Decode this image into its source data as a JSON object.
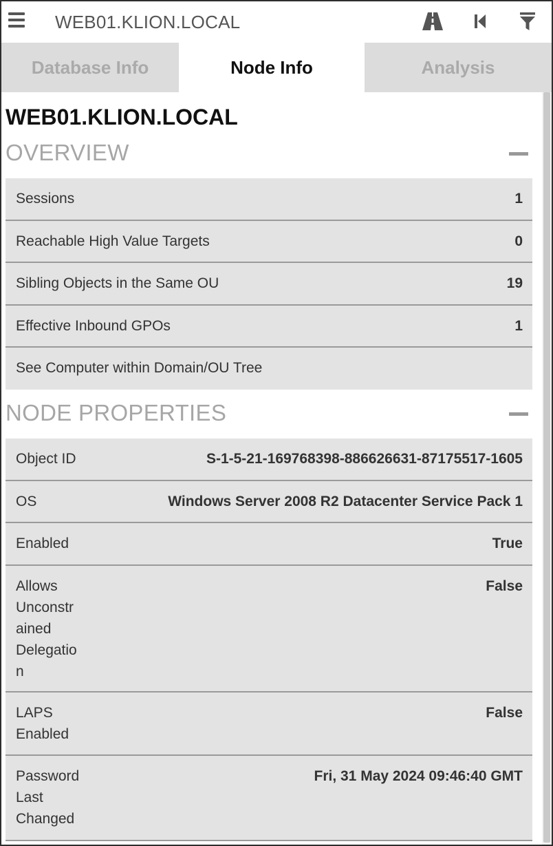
{
  "header": {
    "title": "WEB01.KLION.LOCAL",
    "icons": [
      "menu-icon",
      "road-icon",
      "back-icon",
      "filter-icon"
    ]
  },
  "tabs": [
    {
      "label": "Database Info",
      "active": false
    },
    {
      "label": "Node Info",
      "active": true
    },
    {
      "label": "Analysis",
      "active": false
    }
  ],
  "node": {
    "name": "WEB01.KLION.LOCAL"
  },
  "overview": {
    "title": "OVERVIEW",
    "rows": [
      {
        "label": "Sessions",
        "value": "1"
      },
      {
        "label": "Reachable High Value Targets",
        "value": "0"
      },
      {
        "label": "Sibling Objects in the Same OU",
        "value": "19"
      },
      {
        "label": "Effective Inbound GPOs",
        "value": "1"
      },
      {
        "label": "See Computer within Domain/OU Tree",
        "value": ""
      }
    ]
  },
  "properties": {
    "title": "NODE PROPERTIES",
    "rows": [
      {
        "label": "Object ID",
        "value": "S-1-5-21-169768398-886626631-87175517-1605"
      },
      {
        "label": "OS",
        "value": "Windows Server 2008 R2 Datacenter Service Pack 1"
      },
      {
        "label": "Enabled",
        "value": "True"
      },
      {
        "label": "Allows Unconstrained Delegation",
        "label_lines": [
          "Allows",
          "Unconstr",
          "ained",
          "Delegatio",
          "n"
        ],
        "value": "False"
      },
      {
        "label": "LAPS Enabled",
        "label_lines": [
          "LAPS",
          "Enabled"
        ],
        "value": "False"
      },
      {
        "label": "Password Last Changed",
        "label_lines": [
          "Password",
          "Last",
          "Changed"
        ],
        "value": "Fri, 31 May 2024 09:46:40 GMT"
      }
    ]
  },
  "colors": {
    "tab_inactive_bg": "#dcdcdc",
    "row_bg": "#e3e3e3",
    "section_title": "#a6a6a6"
  }
}
